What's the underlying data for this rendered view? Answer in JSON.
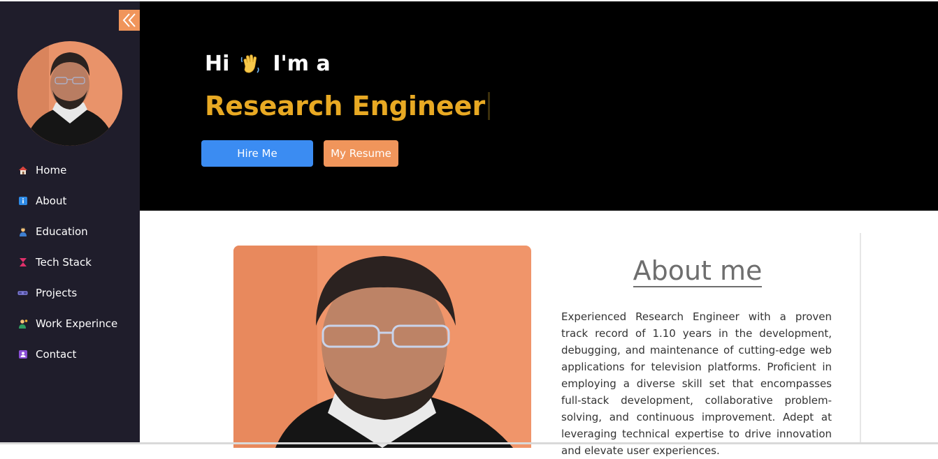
{
  "sidebar": {
    "collapse_icon": "double-chevron-left-icon",
    "items": [
      {
        "label": "Home",
        "icon": "house-icon"
      },
      {
        "label": "About",
        "icon": "info-icon"
      },
      {
        "label": "Education",
        "icon": "student-icon"
      },
      {
        "label": "Tech Stack",
        "icon": "hourglass-icon"
      },
      {
        "label": "Projects",
        "icon": "vr-headset-icon"
      },
      {
        "label": "Work Experince",
        "icon": "technologist-icon"
      },
      {
        "label": "Contact",
        "icon": "contact-card-icon"
      }
    ]
  },
  "hero": {
    "greeting_hi": "Hi",
    "greeting_rest": "I'm a",
    "role": "Research Engineer",
    "hire_button": "Hire Me",
    "resume_button": "My Resume"
  },
  "about": {
    "title": "About me",
    "text": "Experienced Research Engineer with a proven track record of 1.10 years in the development, debugging, and maintenance of cutting-edge web applications for television platforms. Proficient in employing a diverse skill set that encompasses full-stack development, collaborative problem-solving, and continuous improvement. Adept at leveraging technical expertise to drive innovation and elevate user experiences."
  },
  "colors": {
    "sidebar_bg": "#1f1d2b",
    "accent_orange": "#f0955b",
    "accent_blue": "#3b8cf2",
    "role_gold": "#e8a923"
  }
}
